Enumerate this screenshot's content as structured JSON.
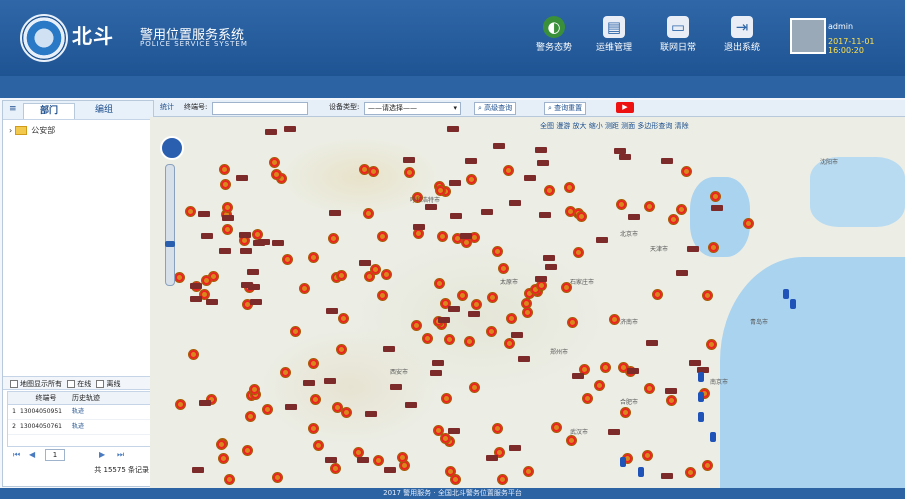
{
  "header": {
    "logo_text": "北斗",
    "title": "警用位置服务系统",
    "subtitle": "POLICE SERVICE SYSTEM",
    "nav": [
      {
        "label": "警务态势",
        "icon": "globe-icon"
      },
      {
        "label": "运维管理",
        "icon": "document-icon"
      },
      {
        "label": "联网日常",
        "icon": "monitor-icon"
      },
      {
        "label": "退出系统",
        "icon": "exit-icon"
      }
    ],
    "user": {
      "name": "admin",
      "time": "2017-11-01 16:00:20"
    }
  },
  "left_panel": {
    "tabs": [
      "部门",
      "编组"
    ],
    "tree_root": "公安部",
    "filter": {
      "all": "地图显示所有",
      "online": "在线",
      "offline": "离线"
    },
    "device_table": {
      "headers": [
        "终端号",
        "历史轨迹"
      ],
      "rows": [
        {
          "idx": "1",
          "id": "13004050951",
          "track": "轨迹"
        },
        {
          "idx": "2",
          "id": "13004050761",
          "track": "轨迹"
        }
      ]
    },
    "pager": {
      "page": "1",
      "total": "共 15575 条记录"
    }
  },
  "toolbar": {
    "stats": "统计",
    "terminal_label": "终端号:",
    "device_type_label": "设备类型:",
    "device_type_value": "——请选择——",
    "advanced_query": "高级查询",
    "query_reset": "查询重置"
  },
  "map_tools": [
    "全图",
    "漫游",
    "放大",
    "缩小",
    "测距",
    "测面",
    "多边形查询",
    "清除"
  ],
  "cities": [
    "沈阳市",
    "呼和浩特市",
    "天津市",
    "北京市",
    "石家庄市",
    "太原市",
    "济南市",
    "青岛市",
    "郑州市",
    "西安市",
    "合肥市",
    "南京市",
    "武汉市"
  ],
  "footer": "2017 警用服务 · 全国北斗警务位置服务平台",
  "colors": {
    "header": "#2f67a8",
    "badge_red": "#e11111",
    "sea": "#aad3ef"
  }
}
